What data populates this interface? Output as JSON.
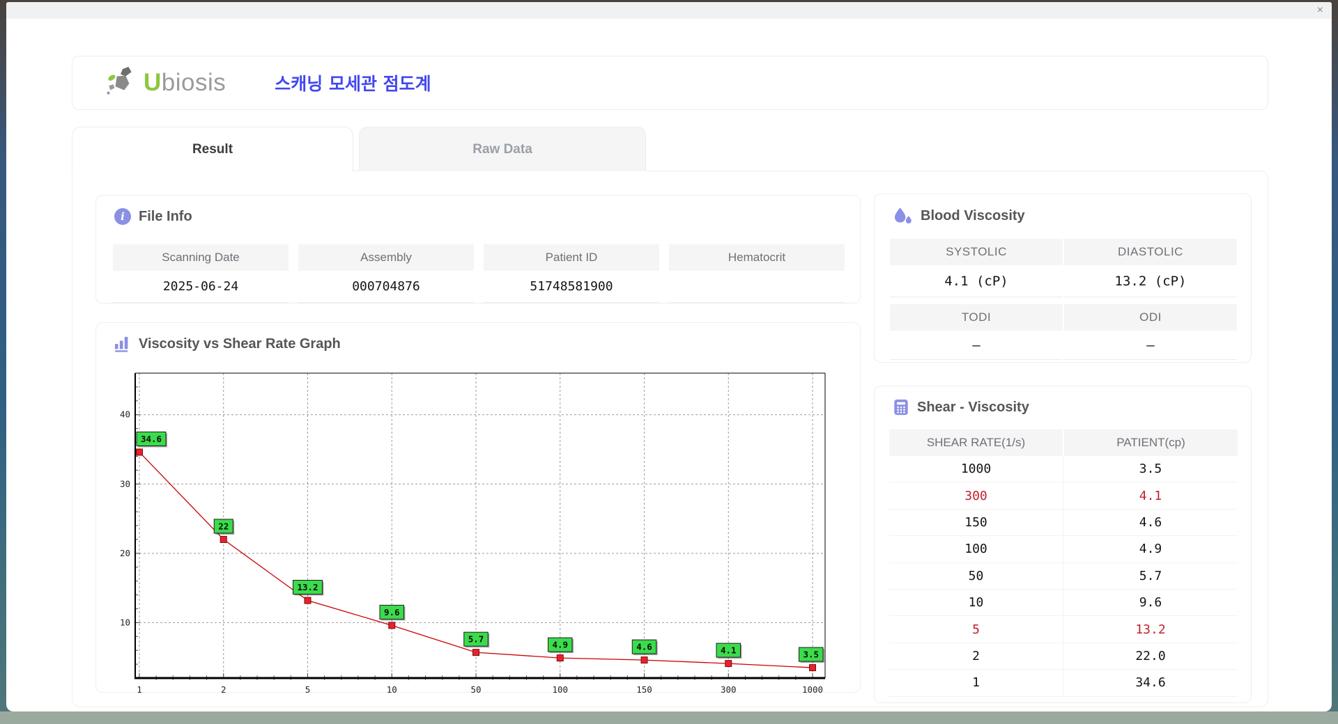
{
  "window": {
    "close_icon": "×"
  },
  "header": {
    "brand_first_letter": "U",
    "brand_rest": "biosis",
    "app_title": "스캐닝 모세관 점도계"
  },
  "tabs": {
    "result": "Result",
    "raw_data": "Raw Data"
  },
  "file_info": {
    "title": "File Info",
    "fields": [
      {
        "label": "Scanning Date",
        "value": "2025-06-24"
      },
      {
        "label": "Assembly",
        "value": "000704876"
      },
      {
        "label": "Patient ID",
        "value": "51748581900"
      },
      {
        "label": "Hematocrit",
        "value": ""
      }
    ]
  },
  "blood_viscosity": {
    "title": "Blood Viscosity",
    "metrics": [
      {
        "label": "SYSTOLIC",
        "value": "4.1 (cP)"
      },
      {
        "label": "DIASTOLIC",
        "value": "13.2 (cP)"
      },
      {
        "label": "TODI",
        "value": "–"
      },
      {
        "label": "ODI",
        "value": "–"
      }
    ]
  },
  "graph": {
    "title": "Viscosity vs Shear Rate Graph"
  },
  "chart_data": {
    "type": "line",
    "title": "Viscosity vs Shear Rate Graph",
    "x_scale": "categorical (log-spaced shear rates, equal spacing)",
    "x": [
      1,
      2,
      5,
      10,
      50,
      100,
      150,
      300,
      1000
    ],
    "series": [
      {
        "name": "PATIENT(cp)",
        "values": [
          34.6,
          22,
          13.2,
          9.6,
          5.7,
          4.9,
          4.6,
          4.1,
          3.5
        ]
      }
    ],
    "point_labels": [
      "34.6",
      "22",
      "13.2",
      "9.6",
      "5.7",
      "4.9",
      "4.6",
      "4.1",
      "3.5"
    ],
    "xlabel": "",
    "ylabel": "",
    "yticks": [
      10,
      20,
      30,
      40
    ],
    "ylim": [
      2,
      46
    ],
    "grid": "dashed",
    "legend": "none",
    "line_color": "#cc0000",
    "marker_color": "#e8212e",
    "marker_border": "#7a0a0a",
    "label_bg": "#3bdc4b",
    "label_border": "#1c1c1c"
  },
  "shear_viscosity": {
    "title": "Shear - Viscosity",
    "columns": [
      "SHEAR RATE(1/s)",
      "PATIENT(cp)"
    ],
    "rows": [
      {
        "rate": "1000",
        "value": "3.5",
        "highlight": false
      },
      {
        "rate": "300",
        "value": "4.1",
        "highlight": true
      },
      {
        "rate": "150",
        "value": "4.6",
        "highlight": false
      },
      {
        "rate": "100",
        "value": "4.9",
        "highlight": false
      },
      {
        "rate": "50",
        "value": "5.7",
        "highlight": false
      },
      {
        "rate": "10",
        "value": "9.6",
        "highlight": false
      },
      {
        "rate": "5",
        "value": "13.2",
        "highlight": true
      },
      {
        "rate": "2",
        "value": "22.0",
        "highlight": false
      },
      {
        "rate": "1",
        "value": "34.6",
        "highlight": false
      }
    ]
  },
  "colors": {
    "accent_icon": "#8a90e4",
    "app_title_blue": "#4348ef",
    "brand_green": "#8dc63f",
    "brand_gray": "#9b9b9b",
    "highlight_red": "#c0202f"
  }
}
